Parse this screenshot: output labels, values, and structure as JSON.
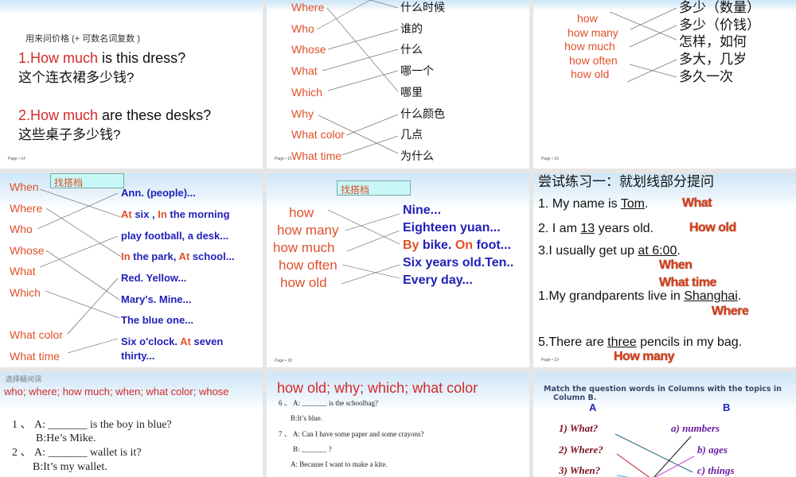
{
  "slides": {
    "s14": {
      "subtitle": "用来问价格 (+ 可数名词复数 )",
      "q1_red": "1.How much",
      "q1_rest": " is this dress?",
      "q1_cn": "这个连衣裙多少钱?",
      "q2_red": "2.How much",
      "q2_rest": " are these desks?",
      "q2_cn": "这些桌子多少钱?",
      "page": "Page • 14"
    },
    "s15": {
      "left": [
        "Where",
        "Who",
        "Whose",
        "What",
        "Which",
        "Why",
        "What color",
        "What time"
      ],
      "right": [
        "什么时候",
        "谁的",
        "什么",
        "哪一个",
        "哪里",
        "什么颜色",
        "几点",
        "为什么"
      ],
      "page": "Page • 15"
    },
    "s16": {
      "left": [
        "how",
        "how many",
        "how much",
        "how often",
        "how old"
      ],
      "right": [
        "多少（数量）",
        "多少（价钱）",
        "怎样，如何",
        "多大，几岁",
        "多久一次"
      ],
      "page": "Page • 16"
    },
    "s17": {
      "box": "找搭档",
      "left": [
        "When",
        "Where",
        "Who",
        "Whose",
        "What",
        "Which",
        "What color",
        "What time"
      ],
      "right": {
        "r0": "Ann. (people)...",
        "r1a": "At",
        "r1b": " six , ",
        "r1c": "In",
        "r1d": " the morning",
        "r2": "play football, a desk...",
        "r3a": "In",
        "r3b": " the park, ",
        "r3c": "At",
        "r3d": " school...",
        "r4": "Red. Yellow...",
        "r5": "Mary's. Mine...",
        "r6": "The blue one...",
        "r7a": "Six o'clock. ",
        "r7b": "At",
        "r7c": " seven",
        "r8": "thirty..."
      }
    },
    "s18": {
      "box": "找搭档",
      "left": [
        "how",
        "how many",
        "how much",
        "how often",
        "how old"
      ],
      "right": {
        "r0": "Nine...",
        "r1": "Eighteen yuan...",
        "r2a": "By",
        "r2b": " bike. ",
        "r2c": "On",
        "r2d": " foot...",
        "r3": "Six years old.Ten..",
        "r4": "Every day..."
      },
      "page": "Page • 18"
    },
    "s19": {
      "title": "尝试练习一：就划线部分提问",
      "l1a": "1. My name is ",
      "l1u": "Tom",
      "l1b": ".",
      "a1": "What",
      "l2a": "2. I am ",
      "l2u": "13",
      "l2b": " years old.",
      "a2": "How old",
      "l3a": "3.I usually get up ",
      "l3u": "at 6:00",
      "l3b": ".",
      "a3": "When",
      "a3b": "What time",
      "l4a": "1.My grandparents live in ",
      "l4u": "Shanghai",
      "l4b": ".",
      "a4": "Where",
      "l5a": "5.There are ",
      "l5u": "three",
      "l5b": " pencils in my bag.",
      "a5": "How many",
      "page": "Page • 19"
    },
    "s20": {
      "label": "选择疑问词",
      "words": "who; where;  how much;  when; what color;  whose",
      "q1": "1 、      A: _______ is the boy in blue?",
      "a1": "B:He’s Mike.",
      "q2": "2 、      A: _______ wallet is it?",
      "a2": "B:It’s my wallet."
    },
    "s21": {
      "words": "how old;  why;   which; what color",
      "q6": "6 、    A: _______ is the schoolbag?",
      "a6": "B:It’s blue.",
      "q7": "7 、  A: Can I have some paper and some crayons?",
      "b7": "B: _______ ?",
      "a7": "A: Because I want to make a kite."
    },
    "s22": {
      "title1": "Match the question words in Columns with  the topics in",
      "title2": "Column B.",
      "colA": "A",
      "colB": "B",
      "left": [
        "1)  What?",
        "2)  Where?",
        "3)  When?"
      ],
      "right": [
        "a)  numbers",
        "b)  ages",
        "c)  things"
      ]
    }
  }
}
